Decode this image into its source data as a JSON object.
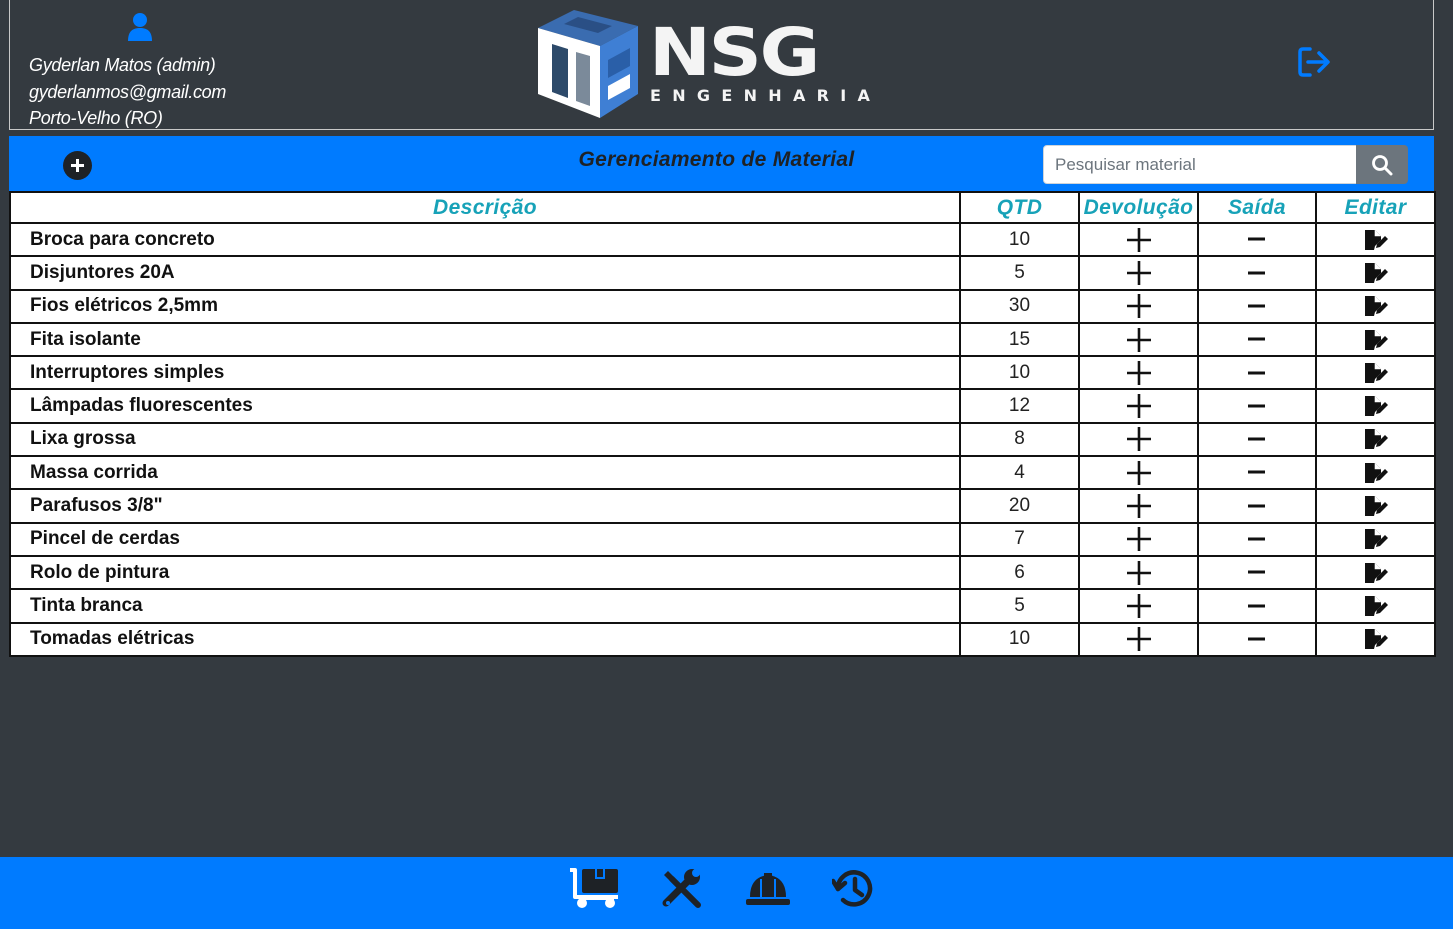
{
  "user": {
    "name": "Gyderlan Matos (admin)",
    "email": "gyderlanmos@gmail.com",
    "location": "Porto-Velho (RO)"
  },
  "logo": {
    "name": "NSG",
    "subtitle": "ENGENHARIA"
  },
  "toolbar": {
    "title": "Gerenciamento de Material",
    "search_placeholder": "Pesquisar material"
  },
  "table": {
    "headers": [
      "Descrição",
      "QTD",
      "Devolução",
      "Saída",
      "Editar"
    ],
    "rows": [
      {
        "description": "Broca para concreto",
        "qtd": "10"
      },
      {
        "description": "Disjuntores 20A",
        "qtd": "5"
      },
      {
        "description": "Fios elétricos 2,5mm",
        "qtd": "30"
      },
      {
        "description": "Fita isolante",
        "qtd": "15"
      },
      {
        "description": "Interruptores simples",
        "qtd": "10"
      },
      {
        "description": "Lâmpadas fluorescentes",
        "qtd": "12"
      },
      {
        "description": "Lixa grossa",
        "qtd": "8"
      },
      {
        "description": "Massa corrida",
        "qtd": "4"
      },
      {
        "description": "Parafusos 3/8\"",
        "qtd": "20"
      },
      {
        "description": "Pincel de cerdas",
        "qtd": "7"
      },
      {
        "description": "Rolo de pintura",
        "qtd": "6"
      },
      {
        "description": "Tinta branca",
        "qtd": "5"
      },
      {
        "description": "Tomadas elétricas",
        "qtd": "10"
      }
    ]
  },
  "footer": {
    "icons": [
      "dolly-boxes-icon",
      "tools-icon",
      "hard-hat-icon",
      "history-icon"
    ]
  },
  "colors": {
    "accent": "#007bff",
    "background": "#343a40",
    "header_text": "#17a2b8"
  }
}
